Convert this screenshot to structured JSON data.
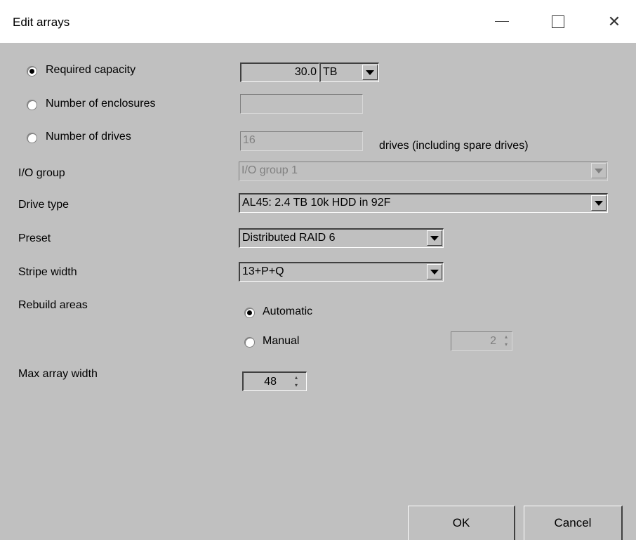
{
  "window": {
    "title": "Edit arrays",
    "close_glyph": "✕"
  },
  "capacity_mode": {
    "options": [
      {
        "label": "Required capacity",
        "selected": true
      },
      {
        "label": "Number of enclosures",
        "selected": false
      },
      {
        "label": "Number of drives",
        "selected": false
      }
    ],
    "required_capacity_value": "30.0",
    "capacity_unit": "TB",
    "enclosures_value": "",
    "drives_value": "16",
    "drives_suffix": "drives (including spare drives)"
  },
  "io_group": {
    "label": "I/O group",
    "value": "I/O group 1",
    "enabled": false
  },
  "drive_type": {
    "label": "Drive type",
    "value": "AL45: 2.4 TB 10k HDD in 92F"
  },
  "preset": {
    "label": "Preset",
    "value": "Distributed RAID 6"
  },
  "stripe_width": {
    "label": "Stripe width",
    "value": "13+P+Q"
  },
  "rebuild_areas": {
    "label": "Rebuild areas",
    "options": [
      {
        "label": "Automatic",
        "selected": true
      },
      {
        "label": "Manual",
        "selected": false
      }
    ],
    "manual_value": "2"
  },
  "max_array_width": {
    "label": "Max array width",
    "value": "48"
  },
  "buttons": {
    "ok": "OK",
    "cancel": "Cancel"
  }
}
